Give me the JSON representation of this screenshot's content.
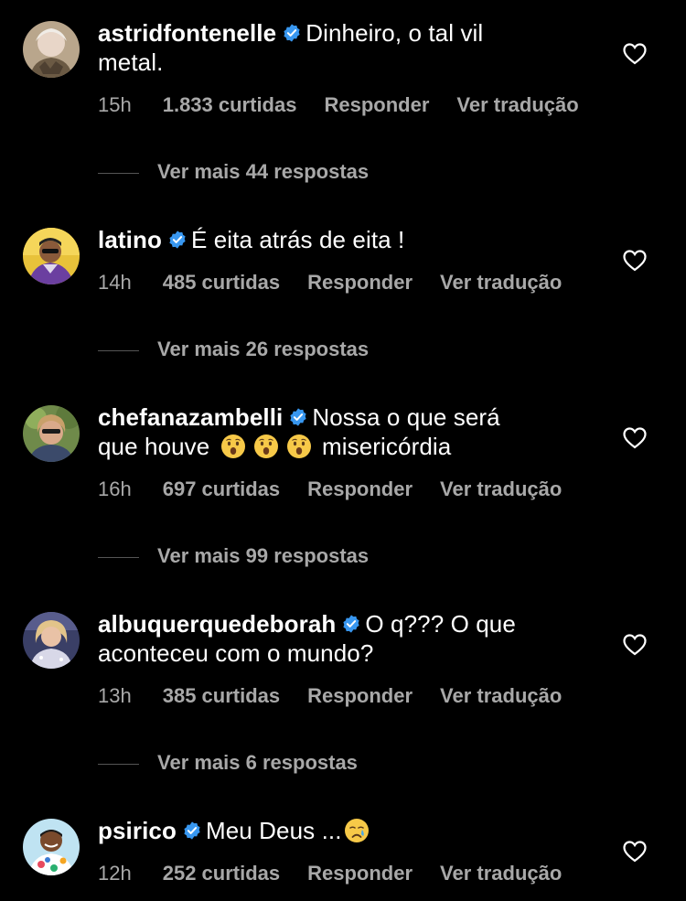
{
  "colors": {
    "background": "#000000",
    "text": "#ffffff",
    "muted": "#a8a8a8",
    "verified": "#3897f0"
  },
  "comments": [
    {
      "username": "astridfontenelle",
      "text_line1": "Dinheiro, o tal vil",
      "text_line2": "metal.",
      "time": "15h",
      "likes": "1.833 curtidas",
      "reply": "Responder",
      "translate": "Ver tradução",
      "view_replies": "Ver mais 44 respostas"
    },
    {
      "username": "latino",
      "text_line1": "É eita atrás de eita !",
      "time": "14h",
      "likes": "485 curtidas",
      "reply": "Responder",
      "translate": "Ver tradução",
      "view_replies": "Ver mais 26 respostas"
    },
    {
      "username": "chefanazambelli",
      "text_line1": "Nossa o que será",
      "text_line2_before": "que houve",
      "text_line2_after": "misericórdia",
      "emoji": "astonished-face-emoji",
      "time": "16h",
      "likes": "697 curtidas",
      "reply": "Responder",
      "translate": "Ver tradução",
      "view_replies": "Ver mais 99 respostas"
    },
    {
      "username": "albuquerquedeborah",
      "text_line1": "O q??? O que",
      "text_line2": "aconteceu com o mundo?",
      "time": "13h",
      "likes": "385 curtidas",
      "reply": "Responder",
      "translate": "Ver tradução",
      "view_replies": "Ver mais 6 respostas"
    },
    {
      "username": "psirico",
      "text_line1": "Meu Deus ...",
      "emoji": "crying-face-emoji",
      "time": "12h",
      "likes": "252 curtidas",
      "reply": "Responder",
      "translate": "Ver tradução"
    }
  ]
}
